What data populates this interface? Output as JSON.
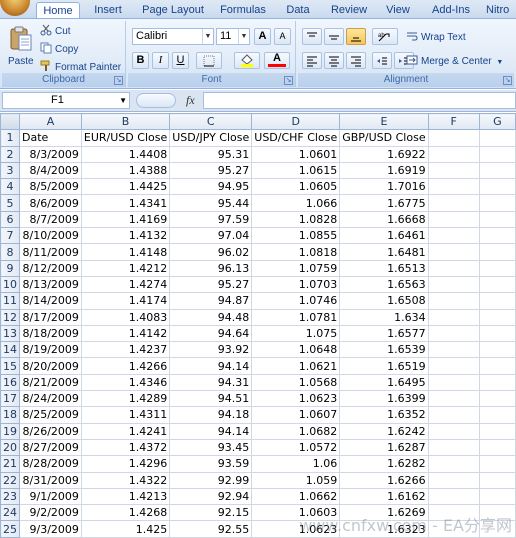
{
  "ribbon_tabs": [
    {
      "label": "Home",
      "active": true
    },
    {
      "label": "Insert"
    },
    {
      "label": "Page Layout"
    },
    {
      "label": "Formulas"
    },
    {
      "label": "Data"
    },
    {
      "label": "Review"
    },
    {
      "label": "View"
    },
    {
      "label": "Add-Ins"
    },
    {
      "label": "Nitro"
    }
  ],
  "clipboard": {
    "paste": "Paste",
    "cut": "Cut",
    "copy": "Copy",
    "format_painter": "Format Painter",
    "group_label": "Clipboard"
  },
  "font": {
    "family": "Calibri",
    "size": "11",
    "grow": "A",
    "shrink": "A",
    "bold": "B",
    "italic": "I",
    "underline": "U",
    "font_color_letter": "A",
    "group_label": "Font"
  },
  "alignment": {
    "wrap_text": "Wrap Text",
    "merge_center": "Merge & Center",
    "group_label": "Alignment"
  },
  "formula_bar": {
    "name_box": "F1",
    "fx": "fx",
    "formula": ""
  },
  "grid": {
    "columns": [
      "A",
      "B",
      "C",
      "D",
      "E",
      "F",
      "G"
    ],
    "rows": [
      [
        "Date",
        "EUR/USD Close",
        "USD/JPY Close",
        "USD/CHF Close",
        "GBP/USD Close",
        "",
        ""
      ],
      [
        "8/3/2009",
        "1.4408",
        "95.31",
        "1.0601",
        "1.6922",
        "",
        ""
      ],
      [
        "8/4/2009",
        "1.4388",
        "95.27",
        "1.0615",
        "1.6919",
        "",
        ""
      ],
      [
        "8/5/2009",
        "1.4425",
        "94.95",
        "1.0605",
        "1.7016",
        "",
        ""
      ],
      [
        "8/6/2009",
        "1.4341",
        "95.44",
        "1.066",
        "1.6775",
        "",
        ""
      ],
      [
        "8/7/2009",
        "1.4169",
        "97.59",
        "1.0828",
        "1.6668",
        "",
        ""
      ],
      [
        "8/10/2009",
        "1.4132",
        "97.04",
        "1.0855",
        "1.6461",
        "",
        ""
      ],
      [
        "8/11/2009",
        "1.4148",
        "96.02",
        "1.0818",
        "1.6481",
        "",
        ""
      ],
      [
        "8/12/2009",
        "1.4212",
        "96.13",
        "1.0759",
        "1.6513",
        "",
        ""
      ],
      [
        "8/13/2009",
        "1.4274",
        "95.27",
        "1.0703",
        "1.6563",
        "",
        ""
      ],
      [
        "8/14/2009",
        "1.4174",
        "94.87",
        "1.0746",
        "1.6508",
        "",
        ""
      ],
      [
        "8/17/2009",
        "1.4083",
        "94.48",
        "1.0781",
        "1.634",
        "",
        ""
      ],
      [
        "8/18/2009",
        "1.4142",
        "94.64",
        "1.075",
        "1.6577",
        "",
        ""
      ],
      [
        "8/19/2009",
        "1.4237",
        "93.92",
        "1.0648",
        "1.6539",
        "",
        ""
      ],
      [
        "8/20/2009",
        "1.4266",
        "94.14",
        "1.0621",
        "1.6519",
        "",
        ""
      ],
      [
        "8/21/2009",
        "1.4346",
        "94.31",
        "1.0568",
        "1.6495",
        "",
        ""
      ],
      [
        "8/24/2009",
        "1.4289",
        "94.51",
        "1.0623",
        "1.6399",
        "",
        ""
      ],
      [
        "8/25/2009",
        "1.4311",
        "94.18",
        "1.0607",
        "1.6352",
        "",
        ""
      ],
      [
        "8/26/2009",
        "1.4241",
        "94.14",
        "1.0682",
        "1.6242",
        "",
        ""
      ],
      [
        "8/27/2009",
        "1.4372",
        "93.45",
        "1.0572",
        "1.6287",
        "",
        ""
      ],
      [
        "8/28/2009",
        "1.4296",
        "93.59",
        "1.06",
        "1.6282",
        "",
        ""
      ],
      [
        "8/31/2009",
        "1.4322",
        "92.99",
        "1.059",
        "1.6266",
        "",
        ""
      ],
      [
        "9/1/2009",
        "1.4213",
        "92.94",
        "1.0662",
        "1.6162",
        "",
        ""
      ],
      [
        "9/2/2009",
        "1.4268",
        "92.15",
        "1.0603",
        "1.6269",
        "",
        ""
      ],
      [
        "9/3/2009",
        "1.425",
        "92.55",
        "1.0623",
        "1.6323",
        "",
        ""
      ]
    ]
  },
  "watermark": "www.cnfxw.com - EA分享网"
}
